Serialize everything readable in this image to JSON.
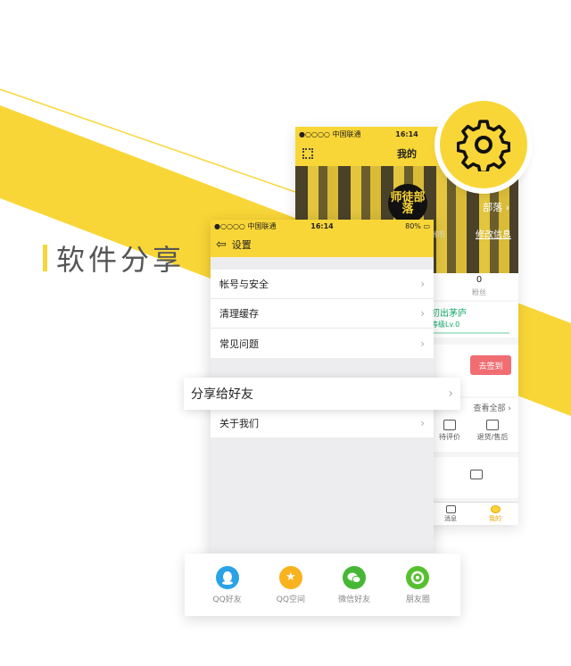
{
  "headline": "软件分享",
  "colors": {
    "brand_yellow": "#f9d637",
    "sign_red": "#f06e72",
    "level_green": "#0fa968"
  },
  "profile_screen": {
    "status": {
      "carrier": "●○○○○ 中国联通",
      "time": "16:14"
    },
    "title": "我的",
    "logo_text": "师徒部落",
    "name_suffix": "部落",
    "edit_link": "修改信息",
    "city": "州市",
    "stats": {
      "count": "0",
      "label": "粉丝"
    },
    "level": {
      "title": "初出茅庐",
      "sub": "等级Lv.0"
    },
    "sign_button": "去签到",
    "view_all": "查看全部",
    "tools": [
      {
        "label": "待评价",
        "icon": "review-icon"
      },
      {
        "label": "退货/售后",
        "icon": "refund-icon"
      }
    ],
    "tabbar": [
      {
        "label": "消息",
        "icon": "message-icon"
      },
      {
        "label": "我的",
        "icon": "profile-icon"
      }
    ]
  },
  "settings_screen": {
    "status": {
      "carrier": "●○○○○ 中国联通",
      "time": "16:14",
      "battery": "80%"
    },
    "title": "设置",
    "rows": [
      {
        "label": "帐号与安全"
      },
      {
        "label": "清理缓存"
      },
      {
        "label": "常见问题"
      }
    ],
    "about_row": {
      "label": "关于我们"
    }
  },
  "highlight_row": {
    "label": "分享给好友"
  },
  "share": [
    {
      "label": "QQ好友",
      "icon": "qq-icon",
      "color": "#2aa3e6"
    },
    {
      "label": "QQ空间",
      "icon": "qzone-icon",
      "color": "#f7b21e"
    },
    {
      "label": "微信好友",
      "icon": "wechat-icon",
      "color": "#45b734"
    },
    {
      "label": "朋友圈",
      "icon": "moments-icon",
      "color": "#57c030"
    }
  ]
}
